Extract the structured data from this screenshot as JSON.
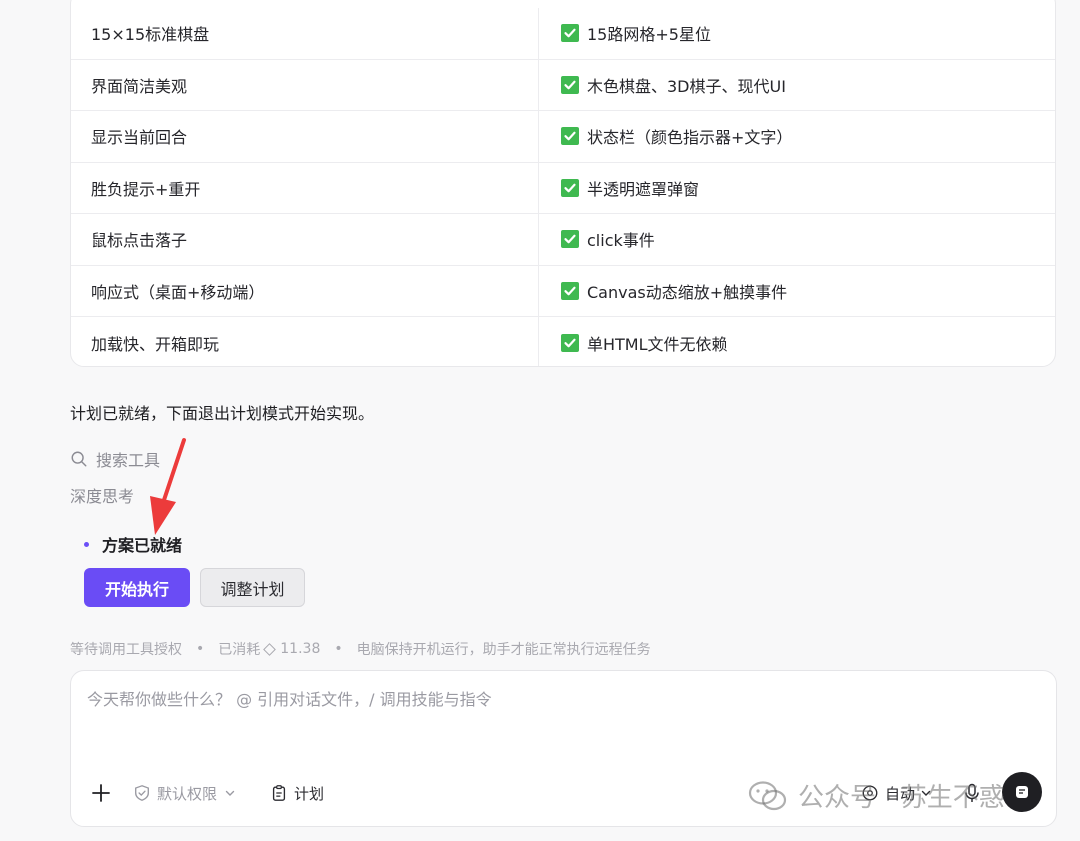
{
  "table": {
    "rows": [
      {
        "requirement": "15×15标准棋盘",
        "implementation": "15路网格+5星位"
      },
      {
        "requirement": "界面简洁美观",
        "implementation": "木色棋盘、3D棋子、现代UI"
      },
      {
        "requirement": "显示当前回合",
        "implementation": "状态栏（颜色指示器+文字）"
      },
      {
        "requirement": "胜负提示+重开",
        "implementation": "半透明遮罩弹窗"
      },
      {
        "requirement": "鼠标点击落子",
        "implementation": "click事件"
      },
      {
        "requirement": "响应式（桌面+移动端）",
        "implementation": "Canvas动态缩放+触摸事件"
      },
      {
        "requirement": "加载快、开箱即玩",
        "implementation": "单HTML文件无依赖"
      }
    ],
    "check_icon": "check-mark-emoji",
    "check_color": "#3fb950"
  },
  "message": "计划已就绪，下面退出计划模式开始实现。",
  "tool_search": {
    "label": "搜索工具",
    "icon": "search-icon"
  },
  "deep_think": {
    "label": "深度思考"
  },
  "plan": {
    "title": "方案已就绪",
    "start_button": "开始执行",
    "adjust_button": "调整计划",
    "accent": "#6a4cf5"
  },
  "status": {
    "waiting": "等待调用工具授权",
    "consumed_label": "已消耗",
    "consumed_value": "11.38",
    "notice": "电脑保持开机运行，助手才能正常执行远程任务"
  },
  "composer": {
    "placeholder": "今天帮你做些什么？ @ 引用对话文件，/ 调用技能与指令",
    "permission_label": "默认权限",
    "plan_label": "计划",
    "mode_label": "自动"
  },
  "watermark": {
    "text": "公众号 · 苏生不惑"
  }
}
